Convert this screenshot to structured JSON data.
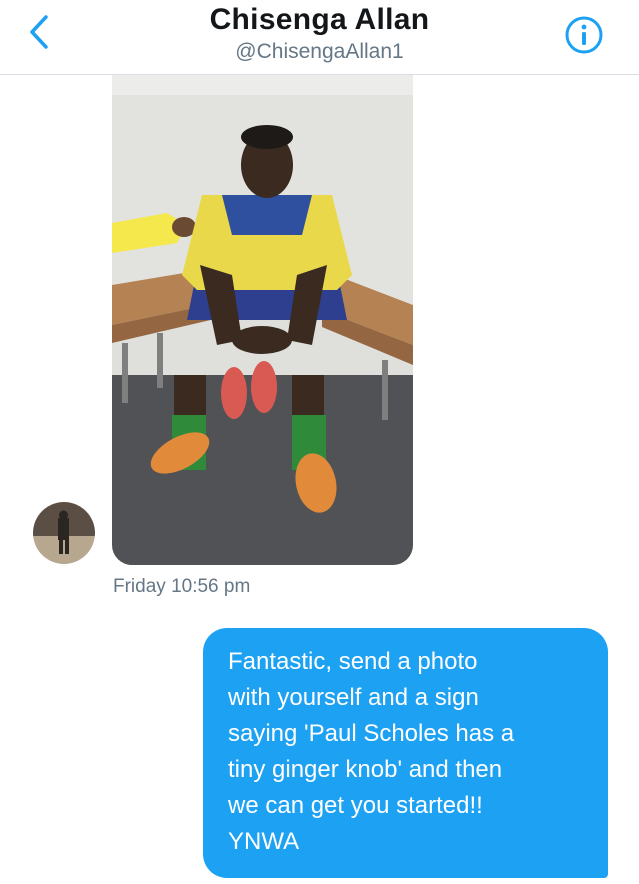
{
  "header": {
    "title": "Chisenga  Allan",
    "handle": "@ChisengaAllan1"
  },
  "theme": {
    "accent": "#1da1f2",
    "title_color": "#14171a",
    "muted": "#657786"
  },
  "icons": {
    "back": "chevron-left-icon",
    "info": "info-icon"
  },
  "conversation": {
    "received": {
      "type": "photo",
      "timestamp": "Friday 10:56 pm"
    },
    "sent": {
      "text": "Fantastic, send a photo\nwith yourself and a sign\nsaying 'Paul Scholes has a\ntiny ginger knob' and then\nwe can get you started!!\nYNWA"
    }
  }
}
